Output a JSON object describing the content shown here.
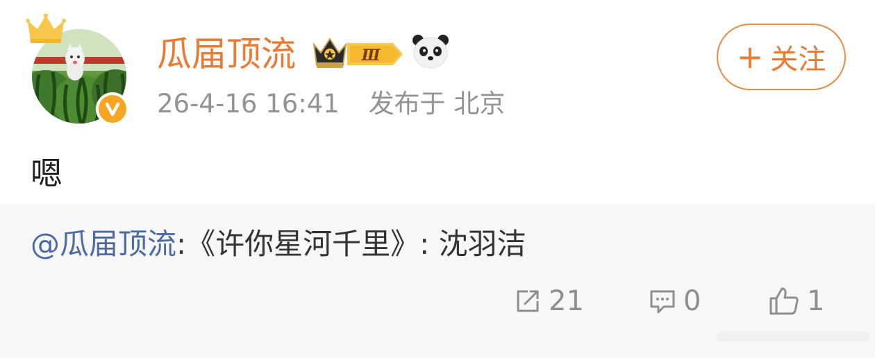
{
  "post": {
    "author": "瓜届顶流",
    "vip_level": "Ⅲ",
    "timestamp": "26-4-16 16:41",
    "source": "发布于 北京",
    "follow_label": "关注",
    "follow_plus": "+",
    "text": "嗯"
  },
  "repost": {
    "mention": "@瓜届顶流",
    "separator": ":",
    "content": "《许你星河千里》: 沈羽洁"
  },
  "actions": {
    "repost_count": "21",
    "comment_count": "0",
    "like_count": "1"
  },
  "icons": {
    "avatar": "avatar-watermelon-cat",
    "crown": "crown-icon",
    "verified": "verified-v-badge",
    "vip": "vip-crown-icon",
    "panda": "panda-icon",
    "repost": "share-icon",
    "comment": "comment-icon",
    "like": "thumbs-up-icon"
  },
  "colors": {
    "accent": "#eb7a32",
    "mention": "#4c6aa4",
    "muted": "#939393",
    "repost_bg": "#f7f7f7"
  }
}
